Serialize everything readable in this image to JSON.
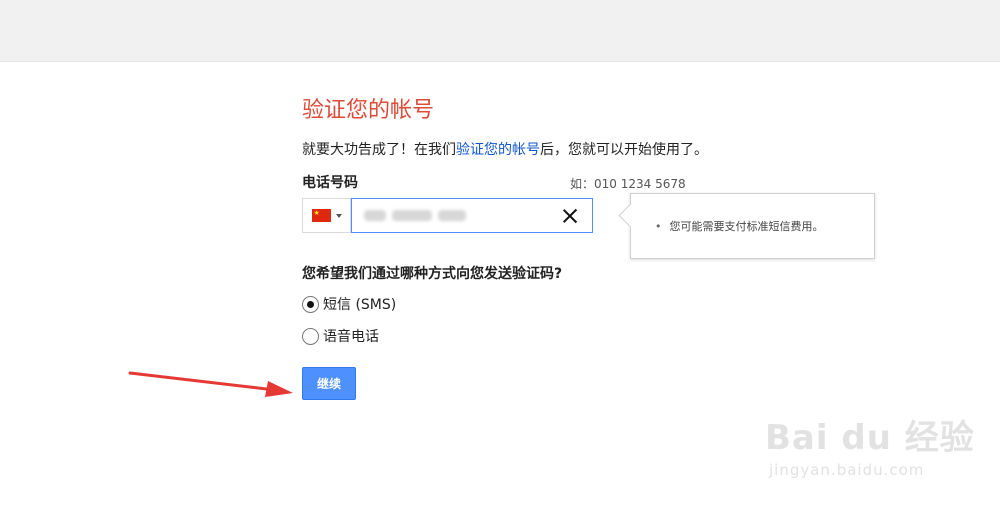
{
  "page": {
    "title": "验证您的帐号",
    "intro_before": "就要大功告成了！在我们",
    "intro_link": "验证您的帐号",
    "intro_after": "后，您就可以开始使用了。"
  },
  "phone": {
    "label": "电话号码",
    "example": "如：010 1234 5678",
    "country_flag": "china-flag",
    "number_value": "[blurred]",
    "clear_icon": "close-icon"
  },
  "tooltip": {
    "text": "您可能需要支付标准短信费用。"
  },
  "method": {
    "question": "您希望我们通过哪种方式向您发送验证码?",
    "options": [
      {
        "label": "短信 (SMS)",
        "selected": true
      },
      {
        "label": "语音电话",
        "selected": false
      }
    ]
  },
  "actions": {
    "continue_label": "继续"
  },
  "watermark": {
    "brand": "Bai du 经验",
    "url": "jingyan.baidu.com"
  },
  "colors": {
    "title": "#dd4b39",
    "link": "#1155cc",
    "button": "#4d90fe",
    "arrow": "#e53935"
  }
}
